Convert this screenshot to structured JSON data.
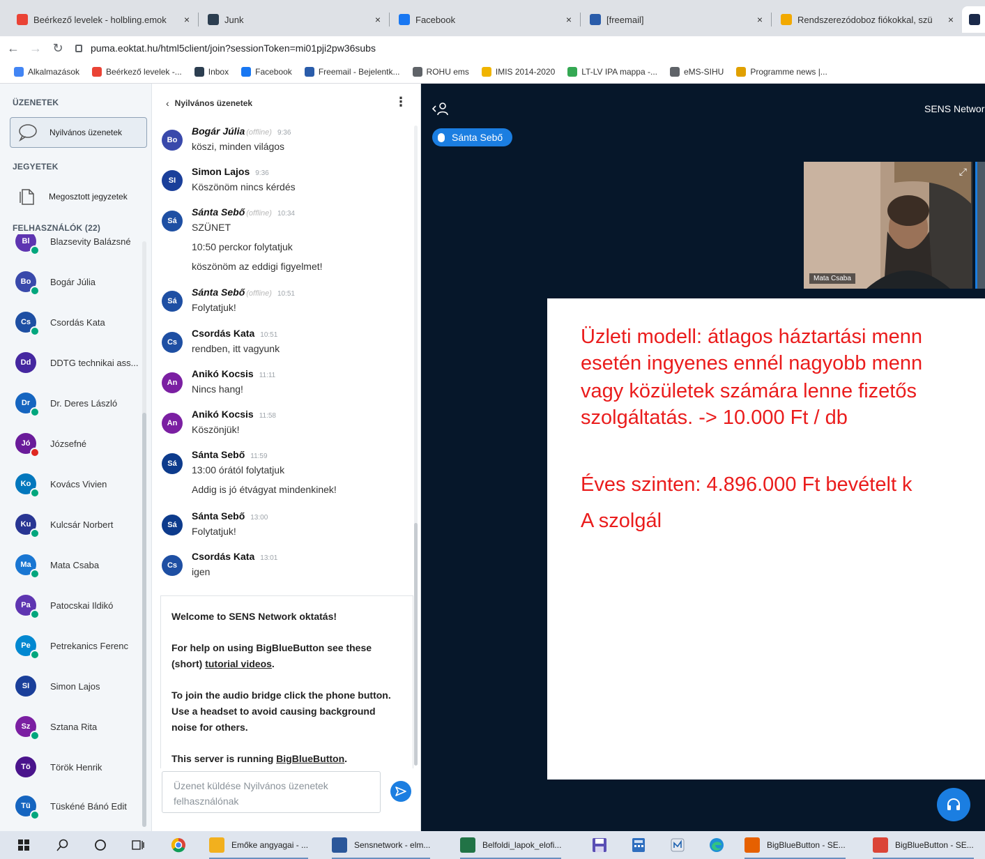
{
  "browser": {
    "tabs": [
      {
        "title": "Beérkező levelek - holbling.emok",
        "icon": "gmail-icon",
        "color": "#ea4335"
      },
      {
        "title": "Junk",
        "icon": "mail-icon",
        "color": "#2c3e50"
      },
      {
        "title": "Facebook",
        "icon": "facebook-icon",
        "color": "#1877f2"
      },
      {
        "title": "[freemail]",
        "icon": "freemail-icon",
        "color": "#2a5caa"
      },
      {
        "title": "Rendszerezódoboz fiókokkal, szü",
        "icon": "shop-icon",
        "color": "#f2a900"
      }
    ],
    "close_glyph": "×",
    "url": "puma.eoktat.hu/html5client/join?sessionToken=mi01pji2pw36subs",
    "bookmarks": [
      {
        "label": "Alkalmazások",
        "icon": "apps-grid-icon",
        "color": "#4285f4"
      },
      {
        "label": "Beérkező levelek -...",
        "icon": "gmail-icon",
        "color": "#ea4335"
      },
      {
        "label": "Inbox",
        "icon": "mail-icon",
        "color": "#2c3e50"
      },
      {
        "label": "Facebook",
        "icon": "facebook-icon",
        "color": "#1877f2"
      },
      {
        "label": "Freemail - Bejelentk...",
        "icon": "freemail-icon",
        "color": "#2a5caa"
      },
      {
        "label": "ROHU ems",
        "icon": "globe-icon",
        "color": "#5f6368"
      },
      {
        "label": "IMIS 2014-2020",
        "icon": "imis-icon",
        "color": "#f0b400"
      },
      {
        "label": "LT-LV IPA mappa -...",
        "icon": "drive-icon",
        "color": "#34a853"
      },
      {
        "label": "eMS-SIHU",
        "icon": "globe-icon",
        "color": "#5f6368"
      },
      {
        "label": "Programme news |...",
        "icon": "news-icon",
        "color": "#e0a000"
      }
    ]
  },
  "userlist": {
    "messages_section": "ÜZENETEK",
    "public_chat_label": "Nyilvános üzenetek",
    "notes_section": "JEGYETEK",
    "shared_notes_label": "Megosztott jegyzetek",
    "users_section": "FELHASZNÁLÓK (22)",
    "users": [
      {
        "initials": "Bl",
        "name": "Blazsevity Balázsné",
        "color": "#5e35b1",
        "mic": "plain"
      },
      {
        "initials": "Bo",
        "name": "Bogár Júlia",
        "color": "#3949ab",
        "mic": "plain"
      },
      {
        "initials": "Cs",
        "name": "Csordás Kata",
        "color": "#1e4fa3",
        "mic": "plain"
      },
      {
        "initials": "Dd",
        "name": "DDTG technikai ass...",
        "color": "#4527a0",
        "mic": "none"
      },
      {
        "initials": "Dr",
        "name": "Dr. Deres László",
        "color": "#1565c0",
        "mic": "plain"
      },
      {
        "initials": "Jó",
        "name": "Józsefné",
        "color": "#6a1b9a",
        "mic": "muted"
      },
      {
        "initials": "Ko",
        "name": "Kovács Vivien",
        "color": "#0277bd",
        "mic": "plain"
      },
      {
        "initials": "Ku",
        "name": "Kulcsár Norbert",
        "color": "#283593",
        "mic": "plain"
      },
      {
        "initials": "Ma",
        "name": "Mata Csaba",
        "color": "#1976d2",
        "mic": "plain"
      },
      {
        "initials": "Pa",
        "name": "Patocskai Ildikó",
        "color": "#5e35b1",
        "mic": "plain"
      },
      {
        "initials": "Pe",
        "name": "Petrekanics Ferenc",
        "color": "#0288d1",
        "mic": "plain"
      },
      {
        "initials": "SI",
        "name": "Simon Lajos",
        "color": "#1a3f9a",
        "mic": "none"
      },
      {
        "initials": "Sz",
        "name": "Sztana Rita",
        "color": "#7b1fa2",
        "mic": "plain"
      },
      {
        "initials": "Tö",
        "name": "Török Henrik",
        "color": "#4a148c",
        "mic": "none"
      },
      {
        "initials": "Tü",
        "name": "Tüskéné Bánó Edit",
        "color": "#1565c0",
        "mic": "plain"
      }
    ]
  },
  "chat": {
    "title": "Nyilvános üzenetek",
    "menu_glyph": "⋮",
    "messages": [
      {
        "initials": "Bo",
        "color": "#3949ab",
        "name": "Bogár Júlia",
        "offline": true,
        "offline_label": "(offline)",
        "time": "9:36",
        "lines": [
          "köszi, minden világos"
        ]
      },
      {
        "initials": "SI",
        "color": "#1a3f9a",
        "name": "Simon Lajos",
        "offline": false,
        "offline_label": "",
        "time": "9:36",
        "lines": [
          "Köszönöm nincs kérdés"
        ]
      },
      {
        "initials": "Sá",
        "color": "#1e4fa3",
        "name": "Sánta Sebő",
        "offline": true,
        "offline_label": "(offline)",
        "time": "10:34",
        "lines": [
          "SZÜNET",
          "10:50 perckor folytatjuk",
          "köszönöm az eddigi figyelmet!"
        ]
      },
      {
        "initials": "Sá",
        "color": "#1e4fa3",
        "name": "Sánta Sebő",
        "offline": true,
        "offline_label": "(offline)",
        "time": "10:51",
        "lines": [
          "Folytatjuk!"
        ]
      },
      {
        "initials": "Cs",
        "color": "#1e4fa3",
        "name": "Csordás Kata",
        "offline": false,
        "offline_label": "",
        "time": "10:51",
        "lines": [
          "rendben, itt vagyunk"
        ]
      },
      {
        "initials": "An",
        "color": "#7b1fa2",
        "name": "Anikó Kocsis",
        "offline": false,
        "offline_label": "",
        "time": "11:11",
        "lines": [
          "Nincs hang!"
        ]
      },
      {
        "initials": "An",
        "color": "#7b1fa2",
        "name": "Anikó Kocsis",
        "offline": false,
        "offline_label": "",
        "time": "11:58",
        "lines": [
          "Köszönjük!"
        ]
      },
      {
        "initials": "Sá",
        "color": "#0d3b8c",
        "name": "Sánta Sebő",
        "offline": false,
        "offline_label": "",
        "time": "11:59",
        "lines": [
          "13:00 órától folytatjuk",
          "Addig is jó étvágyat mindenkinek!"
        ]
      },
      {
        "initials": "Sá",
        "color": "#0d3b8c",
        "name": "Sánta Sebő",
        "offline": false,
        "offline_label": "",
        "time": "13:00",
        "lines": [
          "Folytatjuk!"
        ]
      },
      {
        "initials": "Cs",
        "color": "#1e4fa3",
        "name": "Csordás Kata",
        "offline": false,
        "offline_label": "",
        "time": "13:01",
        "lines": [
          "igen"
        ]
      }
    ],
    "welcome": {
      "line1": "Welcome to SENS Network oktatás!",
      "help_prefix": "For help on using BigBlueButton see these (short) ",
      "help_link": "tutorial videos",
      "help_suffix": ".",
      "audio": "To join the audio bridge click the phone button. Use a headset to avoid causing background noise for others.",
      "server_prefix": "This server is running ",
      "server_link": "BigBlueButton",
      "server_suffix": "."
    },
    "input_placeholder": "Üzenet küldése Nyilvános üzenetek felhasználónak"
  },
  "presentation": {
    "meeting_title": "SENS Networ",
    "talking_user": "Sánta Sebő",
    "webcam_name": "Mata Csaba",
    "slide_lines": [
      "Üzleti modell: átlagos háztartási menn",
      "esetén ingyenes ennél nagyobb menn",
      "vagy közületek számára lenne fizetős",
      "szolgáltatás. -> 10.000 Ft / db",
      "",
      "Éves szinten: 4.896.000 Ft bevételt k",
      "A szolgál"
    ],
    "slide_color": "#ea1c1c",
    "accent": "#1b7ee1",
    "background": "#06172a"
  },
  "taskbar": {
    "apps": [
      {
        "label": "Emőke angyagai - ...",
        "icon": "folder-icon",
        "color": "#f2b01e"
      },
      {
        "label": "Sensnetwork - elm...",
        "icon": "word-icon",
        "color": "#2b579a"
      },
      {
        "label": "Belfoldi_lapok_elofi...",
        "icon": "excel-icon",
        "color": "#217346"
      },
      {
        "label": "BigBlueButton - SE...",
        "icon": "firefox-icon",
        "color": "#e66000"
      },
      {
        "label": "BigBlueButton - SE...",
        "icon": "chrome-icon",
        "color": "#db4437"
      }
    ]
  }
}
